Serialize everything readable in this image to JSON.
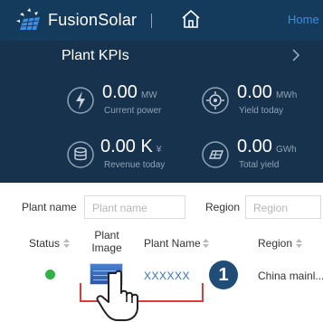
{
  "header": {
    "brand": "FusionSolar",
    "home_link": "Home"
  },
  "kpi": {
    "title": "Plant KPIs",
    "items": [
      {
        "value": "0.00",
        "unit": "MW",
        "label": "Current power"
      },
      {
        "value": "0.00",
        "unit": "MWh",
        "label": "Yield today"
      },
      {
        "value": "0.00 K",
        "unit": "¥",
        "label": "Revenue today"
      },
      {
        "value": "0.00",
        "unit": "GWh",
        "label": "Total yield"
      }
    ]
  },
  "filters": {
    "plant_name_label": "Plant name",
    "plant_name_placeholder": "Plant name",
    "region_label": "Region",
    "region_placeholder": "Region"
  },
  "table": {
    "columns": [
      "Status",
      "Plant\nImage",
      "Plant Name",
      "Region"
    ],
    "rows": [
      {
        "status": "online",
        "plant_name": "XXXXXX",
        "region": "China mainl..."
      }
    ]
  },
  "callout": {
    "step": "1"
  },
  "colors": {
    "topbar": "#143a5c",
    "panel": "#17324d",
    "status_online": "#2fb347",
    "link": "#2f6fd6",
    "annotation": "#e03a3a"
  }
}
